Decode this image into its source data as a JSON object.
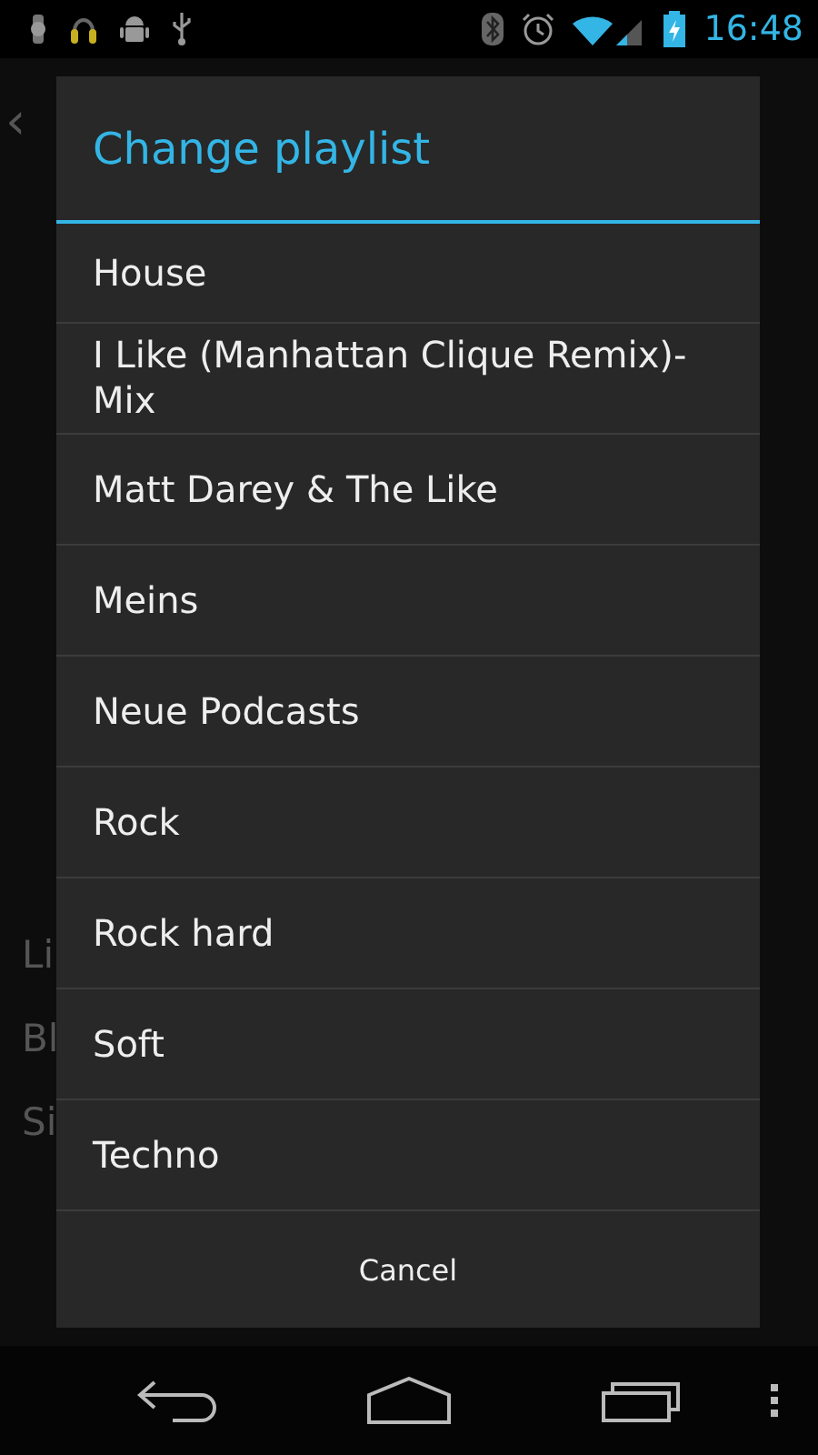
{
  "status_bar": {
    "time": "16:48"
  },
  "background": {
    "back_glyph": "‹",
    "partial_texts": [
      "Li",
      "Bl",
      "Si"
    ]
  },
  "dialog": {
    "title": "Change playlist",
    "items": [
      {
        "label": "House"
      },
      {
        "label": "I Like (Manhattan Clique Remix)-Mix"
      },
      {
        "label": "Matt Darey & The Like"
      },
      {
        "label": "Meins"
      },
      {
        "label": "Neue Podcasts"
      },
      {
        "label": "Rock"
      },
      {
        "label": "Rock hard"
      },
      {
        "label": "Soft"
      },
      {
        "label": "Techno"
      }
    ],
    "cancel": "Cancel"
  }
}
